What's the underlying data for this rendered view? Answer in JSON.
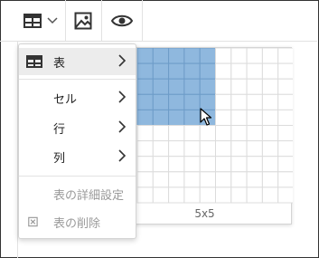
{
  "toolbar": {
    "buttons": [
      {
        "icon": "table-icon",
        "has_dropdown": true
      },
      {
        "icon": "image-icon"
      },
      {
        "icon": "eye-icon"
      }
    ]
  },
  "table_picker": {
    "rows": 10,
    "cols": 10,
    "selected_rows": 5,
    "selected_cols": 5,
    "size_label": "5x5",
    "highlight_color": "#8fb8de"
  },
  "menu": {
    "items": [
      {
        "label": "表",
        "icon": "table-icon",
        "submenu": true,
        "active": true
      },
      {
        "label": "セル",
        "submenu": true
      },
      {
        "label": "行",
        "submenu": true
      },
      {
        "label": "列",
        "submenu": true
      },
      {
        "label": "表の詳細設定",
        "disabled": true
      },
      {
        "label": "表の削除",
        "icon": "delete-table-icon",
        "disabled": true
      }
    ]
  }
}
